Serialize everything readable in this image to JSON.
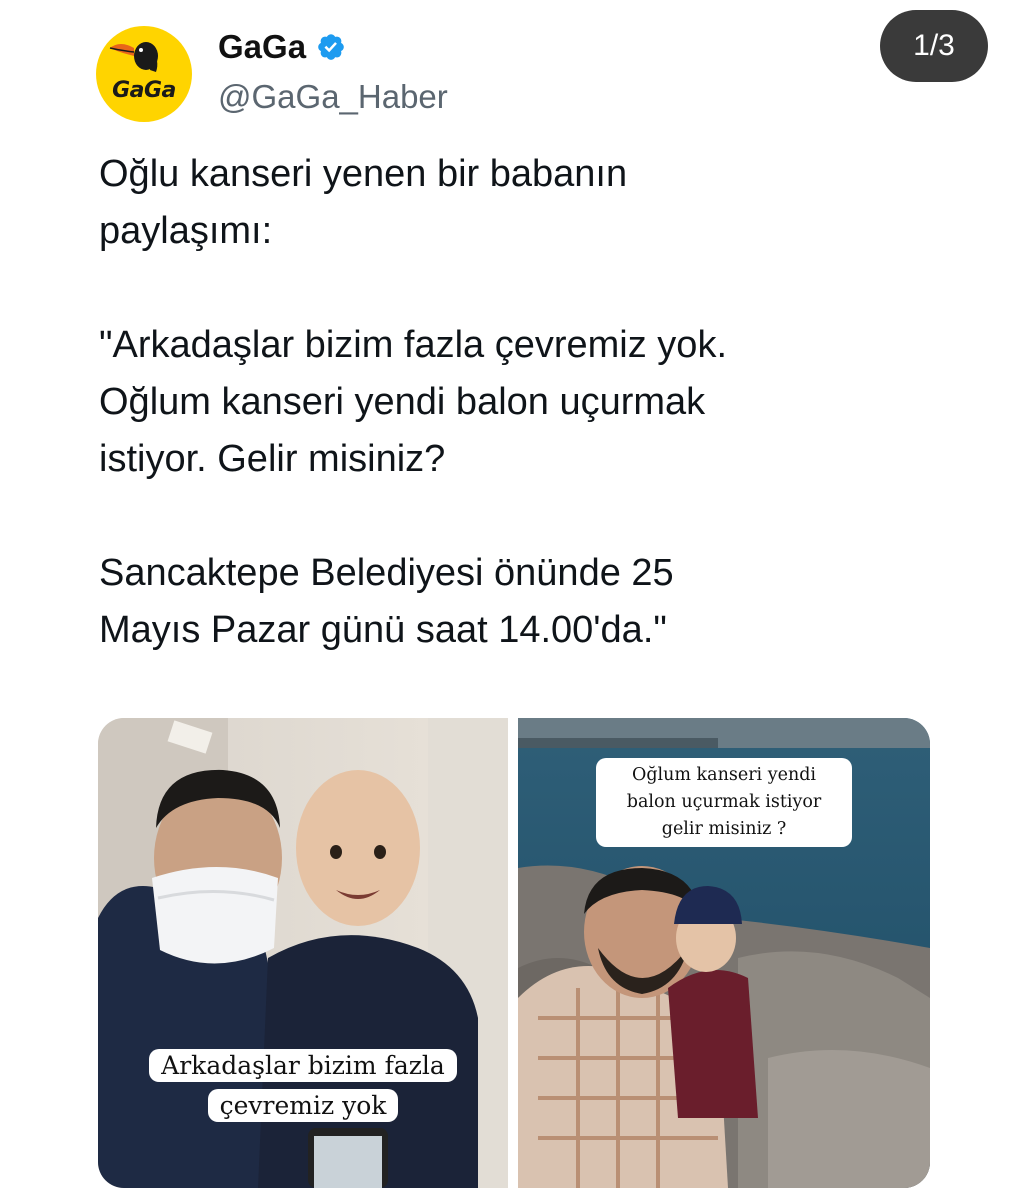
{
  "account": {
    "display_name": "GaGa",
    "handle": "@GaGa_Haber",
    "avatar_text": "GaGa",
    "avatar_bg": "#ffd400",
    "verified_icon": "verified-badge-icon",
    "verified_color": "#1d9bf0"
  },
  "media_counter": "1/3",
  "tweet": {
    "paragraphs": [
      "Oğlu kanseri yenen bir babanın\npaylaşımı:",
      "\"Arkadaşlar bizim fazla çevremiz yok.\nOğlum kanseri yendi balon uçurmak\nistiyor. Gelir misiniz?",
      "Sancaktepe Belediyesi önünde 25\nMayıs Pazar günü saat 14.00'da.\""
    ]
  },
  "media": [
    {
      "caption": "Arkadaşlar bizim fazla çevremiz yok"
    },
    {
      "caption": "Oğlum kanseri yendi\nbalon uçurmak istiyor\ngelir misiniz ?"
    }
  ]
}
